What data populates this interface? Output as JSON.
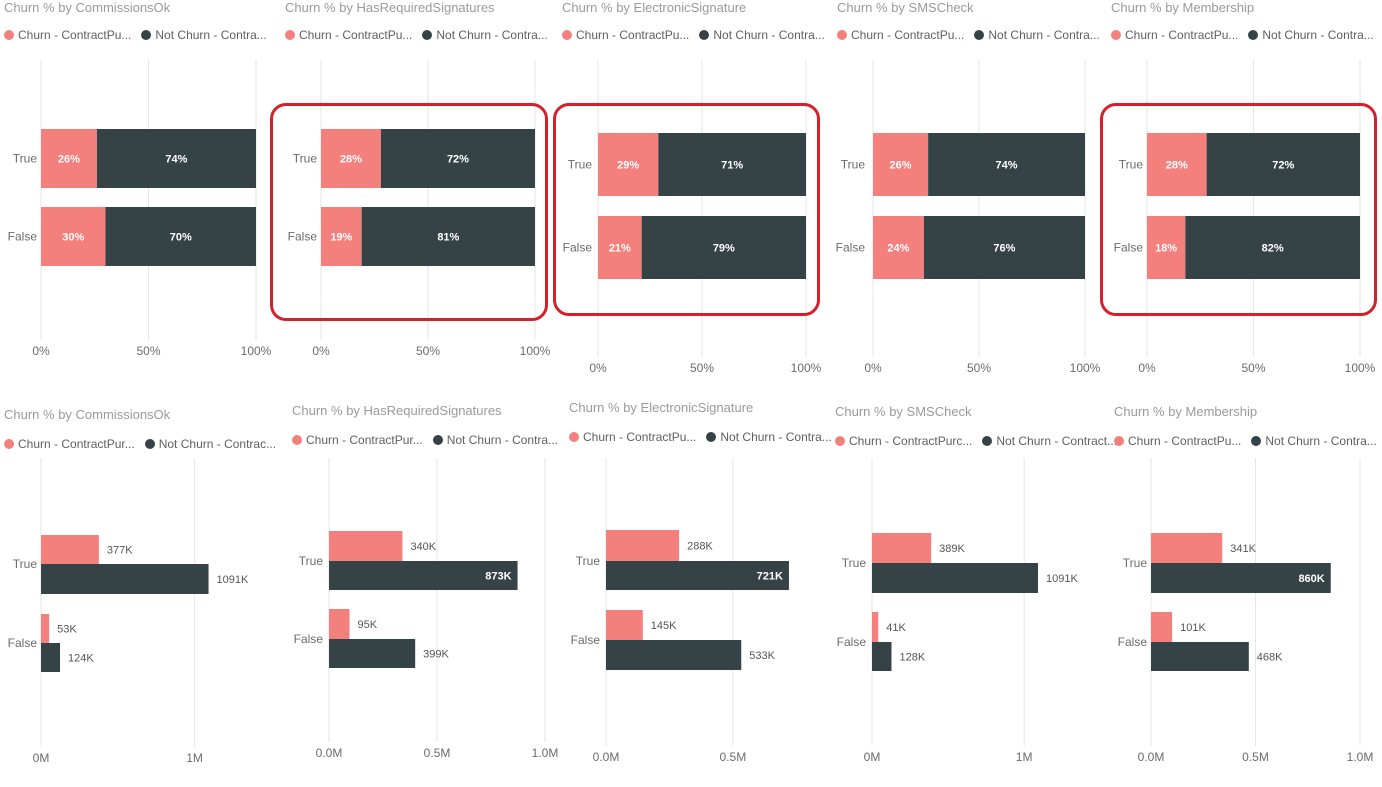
{
  "colors": {
    "churn": "#f4807e",
    "not_churn": "#364346",
    "grid": "#e6e6e6",
    "axis_text": "#6b6b6b",
    "highlight": "#d4202a"
  },
  "chart_data": [
    {
      "type": "bar",
      "stacked": "100%",
      "title": "Churn % by CommissionsOk",
      "legend": [
        "Churn - ContractPu...",
        "Not Churn - Contra..."
      ],
      "categories": [
        "True",
        "False"
      ],
      "series": [
        {
          "name": "Churn - ContractPu...",
          "values": [
            26,
            30
          ]
        },
        {
          "name": "Not Churn - Contra...",
          "values": [
            74,
            70
          ]
        }
      ],
      "xticks": [
        "0%",
        "50%",
        "100%"
      ],
      "xlim": [
        0,
        100
      ],
      "grid": true,
      "legend_position": "top-left"
    },
    {
      "type": "bar",
      "stacked": "100%",
      "title": "Churn % by HasRequiredSignatures",
      "legend": [
        "Churn - ContractPu...",
        "Not Churn - Contra..."
      ],
      "categories": [
        "True",
        "False"
      ],
      "series": [
        {
          "name": "Churn - ContractPu...",
          "values": [
            28,
            19
          ]
        },
        {
          "name": "Not Churn - Contra...",
          "values": [
            72,
            81
          ]
        }
      ],
      "xticks": [
        "0%",
        "50%",
        "100%"
      ],
      "xlim": [
        0,
        100
      ],
      "grid": true,
      "legend_position": "top-left",
      "highlighted": true
    },
    {
      "type": "bar",
      "stacked": "100%",
      "title": "Churn % by ElectronicSignature",
      "legend": [
        "Churn - ContractPu...",
        "Not Churn - Contra..."
      ],
      "categories": [
        "True",
        "False"
      ],
      "series": [
        {
          "name": "Churn - ContractPu...",
          "values": [
            29,
            21
          ]
        },
        {
          "name": "Not Churn - Contra...",
          "values": [
            71,
            79
          ]
        }
      ],
      "xticks": [
        "0%",
        "50%",
        "100%"
      ],
      "xlim": [
        0,
        100
      ],
      "grid": true,
      "legend_position": "top-left",
      "highlighted": true
    },
    {
      "type": "bar",
      "stacked": "100%",
      "title": "Churn % by SMSCheck",
      "legend": [
        "Churn - ContractPu...",
        "Not Churn - Contra..."
      ],
      "categories": [
        "True",
        "False"
      ],
      "series": [
        {
          "name": "Churn - ContractPu...",
          "values": [
            26,
            24
          ]
        },
        {
          "name": "Not Churn - Contra...",
          "values": [
            74,
            76
          ]
        }
      ],
      "xticks": [
        "0%",
        "50%",
        "100%"
      ],
      "xlim": [
        0,
        100
      ],
      "grid": true,
      "legend_position": "top-left"
    },
    {
      "type": "bar",
      "stacked": "100%",
      "title": "Churn % by Membership",
      "legend": [
        "Churn - ContractPu...",
        "Not Churn - Contra..."
      ],
      "categories": [
        "True",
        "False"
      ],
      "series": [
        {
          "name": "Churn - ContractPu...",
          "values": [
            28,
            18
          ]
        },
        {
          "name": "Not Churn - Contra...",
          "values": [
            72,
            82
          ]
        }
      ],
      "xticks": [
        "0%",
        "50%",
        "100%"
      ],
      "xlim": [
        0,
        100
      ],
      "grid": true,
      "legend_position": "top-left",
      "highlighted": true
    },
    {
      "type": "bar",
      "grouped": true,
      "title": "Churn % by CommissionsOk",
      "legend": [
        "Churn - ContractPur...",
        "Not Churn - Contrac..."
      ],
      "categories": [
        "True",
        "False"
      ],
      "series": [
        {
          "name": "Churn - ContractPur...",
          "values": [
            377,
            53
          ],
          "labels": [
            "377K",
            "53K"
          ]
        },
        {
          "name": "Not Churn - Contrac...",
          "values": [
            1091,
            124
          ],
          "labels": [
            "1091K",
            "124K"
          ]
        }
      ],
      "xticks": [
        "0M",
        "1M"
      ],
      "xtick_values": [
        0,
        1000
      ],
      "xlim": [
        0,
        1400
      ],
      "grid": true,
      "legend_position": "top-left"
    },
    {
      "type": "bar",
      "grouped": true,
      "title": "Churn % by HasRequiredSignatures",
      "legend": [
        "Churn - ContractPur...",
        "Not Churn - Contra..."
      ],
      "categories": [
        "True",
        "False"
      ],
      "series": [
        {
          "name": "Churn - ContractPur...",
          "values": [
            340,
            95
          ],
          "labels": [
            "340K",
            "95K"
          ]
        },
        {
          "name": "Not Churn - Contra...",
          "values": [
            873,
            399
          ],
          "labels": [
            "873K",
            "399K"
          ]
        }
      ],
      "xticks": [
        "0.0M",
        "0.5M",
        "1.0M"
      ],
      "xtick_values": [
        0,
        500,
        1000
      ],
      "xlim": [
        0,
        1000
      ],
      "grid": true,
      "legend_position": "top-left"
    },
    {
      "type": "bar",
      "grouped": true,
      "title": "Churn % by ElectronicSignature",
      "legend": [
        "Churn - ContractPu...",
        "Not Churn - Contra..."
      ],
      "categories": [
        "True",
        "False"
      ],
      "series": [
        {
          "name": "Churn - ContractPu...",
          "values": [
            288,
            145
          ],
          "labels": [
            "288K",
            "145K"
          ]
        },
        {
          "name": "Not Churn - Contra...",
          "values": [
            721,
            533
          ],
          "labels": [
            "721K",
            "533K"
          ]
        }
      ],
      "xticks": [
        "0.0M",
        "0.5M"
      ],
      "xtick_values": [
        0,
        500
      ],
      "xlim": [
        0,
        800
      ],
      "grid": true,
      "legend_position": "top-left"
    },
    {
      "type": "bar",
      "grouped": true,
      "title": "Churn % by SMSCheck",
      "legend": [
        "Churn - ContractPurc...",
        "Not Churn - Contract..."
      ],
      "categories": [
        "True",
        "False"
      ],
      "series": [
        {
          "name": "Churn - ContractPurc...",
          "values": [
            389,
            41
          ],
          "labels": [
            "389K",
            "41K"
          ]
        },
        {
          "name": "Not Churn - Contract...",
          "values": [
            1091,
            128
          ],
          "labels": [
            "1091K",
            "128K"
          ]
        }
      ],
      "xticks": [
        "0M",
        "1M"
      ],
      "xtick_values": [
        0,
        1000
      ],
      "xlim": [
        0,
        1400
      ],
      "grid": true,
      "legend_position": "top-left"
    },
    {
      "type": "bar",
      "grouped": true,
      "title": "Churn % by Membership",
      "legend": [
        "Churn - ContractPu...",
        "Not Churn - Contra..."
      ],
      "categories": [
        "True",
        "False"
      ],
      "series": [
        {
          "name": "Churn - ContractPu...",
          "values": [
            341,
            101
          ],
          "labels": [
            "341K",
            "101K"
          ]
        },
        {
          "name": "Not Churn - Contra...",
          "values": [
            860,
            468
          ],
          "labels": [
            "860K",
            "468K"
          ]
        }
      ],
      "xticks": [
        "0.0M",
        "0.5M",
        "1.0M"
      ],
      "xtick_values": [
        0,
        500,
        1000
      ],
      "xlim": [
        0,
        1000
      ],
      "grid": true,
      "legend_position": "top-left"
    }
  ]
}
